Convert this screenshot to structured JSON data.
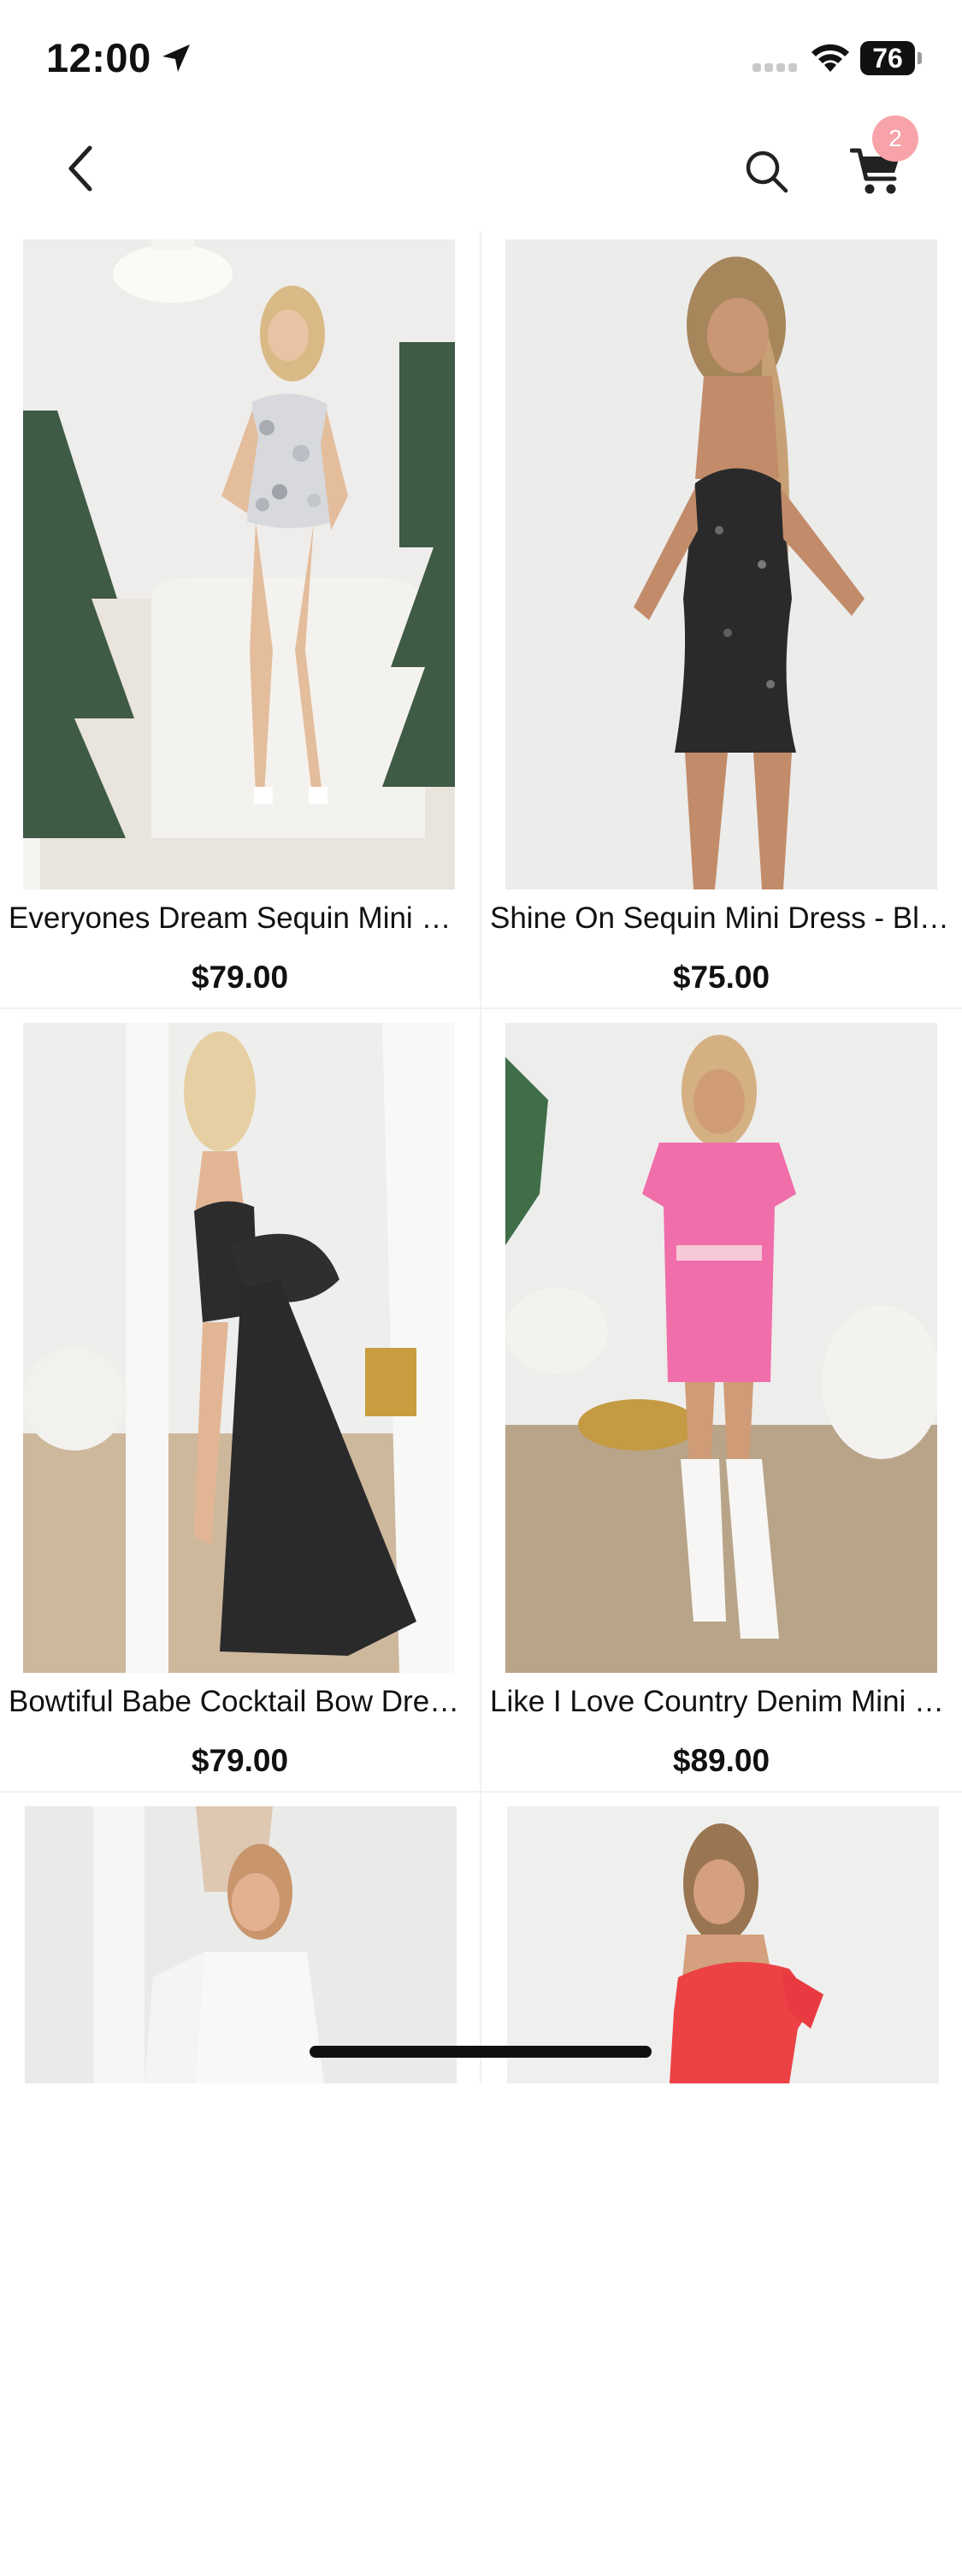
{
  "status_bar": {
    "time": "12:00",
    "battery": "76"
  },
  "nav": {
    "cart_count": "2"
  },
  "products": [
    {
      "title": "Everyones Dream Sequin Mini Dress - Silver",
      "price": "$79.00"
    },
    {
      "title": "Shine On Sequin Mini Dress - Black",
      "price": "$75.00"
    },
    {
      "title": "Bowtiful Babe Cocktail Bow Dress - Black",
      "price": "$79.00"
    },
    {
      "title": "Like I Love Country Denim Mini Dress - Pink",
      "price": "$89.00"
    }
  ],
  "colors": {
    "badge": "#f7a3a9",
    "divider": "#f1f1f1",
    "text": "#111111"
  }
}
